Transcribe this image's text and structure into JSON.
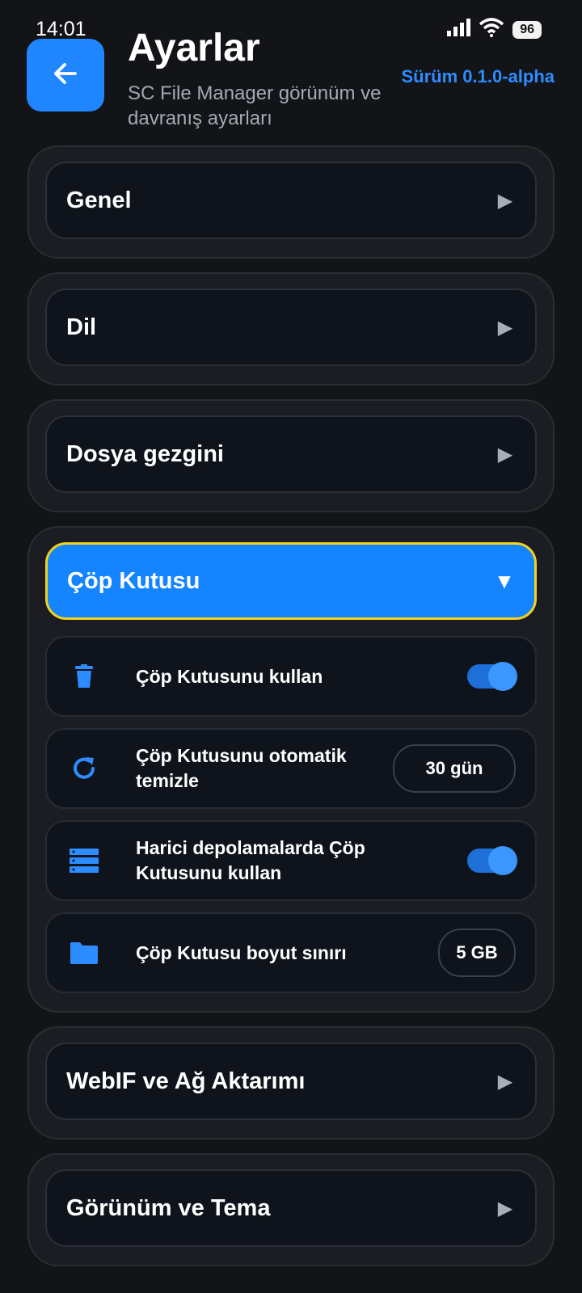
{
  "status_bar": {
    "time": "14:01",
    "battery": "96"
  },
  "header": {
    "title": "Ayarlar",
    "subtitle": "SC File Manager görünüm ve davranış ayarları",
    "version": "Sürüm 0.1.0-alpha"
  },
  "sections": {
    "general": {
      "title": "Genel"
    },
    "language": {
      "title": "Dil"
    },
    "file_browser": {
      "title": "Dosya gezgini"
    },
    "trash": {
      "title": "Çöp Kutusu",
      "expanded": true,
      "rows": {
        "use_trash": {
          "label": "Çöp Kutusunu kullan",
          "icon": "trash-icon",
          "enabled": true
        },
        "auto_clean": {
          "label": "Çöp Kutusunu otomatik temizle",
          "icon": "refresh-icon",
          "value": "30 gün"
        },
        "external": {
          "label": "Harici depolamalarda Çöp Kutusunu kullan",
          "icon": "storage-icon",
          "enabled": true
        },
        "size_limit": {
          "label": "Çöp Kutusu boyut sınırı",
          "icon": "folder-icon",
          "value": "5 GB"
        }
      }
    },
    "webif": {
      "title": "WebIF ve Ağ Aktarımı"
    },
    "theme": {
      "title": "Görünüm ve Tema"
    }
  },
  "colors": {
    "accent": "#1f86ff",
    "highlight_border": "#f2d21d",
    "background": "#121418"
  }
}
